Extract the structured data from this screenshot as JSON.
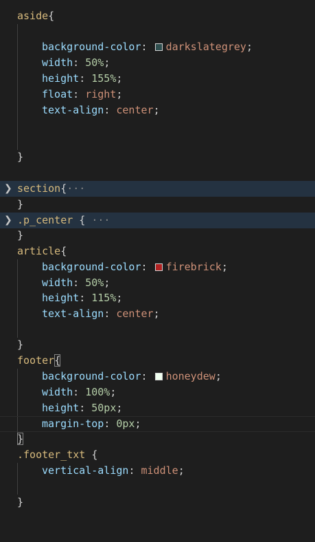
{
  "editor": {
    "aside": {
      "selector": "aside",
      "open": "{",
      "close": "}",
      "decls": [
        {
          "prop": "background-color",
          "value": "darkslategrey",
          "swatch": "#2f4f4f"
        },
        {
          "prop": "width",
          "value": "50%"
        },
        {
          "prop": "height",
          "value": "155%"
        },
        {
          "prop": "float",
          "value": "right"
        },
        {
          "prop": "text-align",
          "value": "center"
        }
      ]
    },
    "section": {
      "selector": "section",
      "open": "{",
      "ellipsis": "···",
      "close": "}"
    },
    "p_center": {
      "selector": ".p_center",
      "open": " {",
      "ellipsis": "···",
      "close": "}"
    },
    "article": {
      "selector": "article",
      "open": "{",
      "close": "}",
      "decls": [
        {
          "prop": "background-color",
          "value": "firebrick",
          "swatch": "#b22222"
        },
        {
          "prop": "width",
          "value": "50%"
        },
        {
          "prop": "height",
          "value": "115%"
        },
        {
          "prop": "text-align",
          "value": "center"
        }
      ]
    },
    "footer": {
      "selector": "footer",
      "open": "{",
      "close": "}",
      "decls": [
        {
          "prop": "background-color",
          "value": "honeydew",
          "swatch": "#f0fff0"
        },
        {
          "prop": "width",
          "value": "100%"
        },
        {
          "prop": "height",
          "value": "50px"
        },
        {
          "prop": "margin-top",
          "value": "0px"
        }
      ]
    },
    "footer_txt": {
      "selector": ".footer_txt",
      "open": " {",
      "close": "}",
      "decls": [
        {
          "prop": "vertical-align",
          "value": "middle"
        }
      ]
    }
  }
}
